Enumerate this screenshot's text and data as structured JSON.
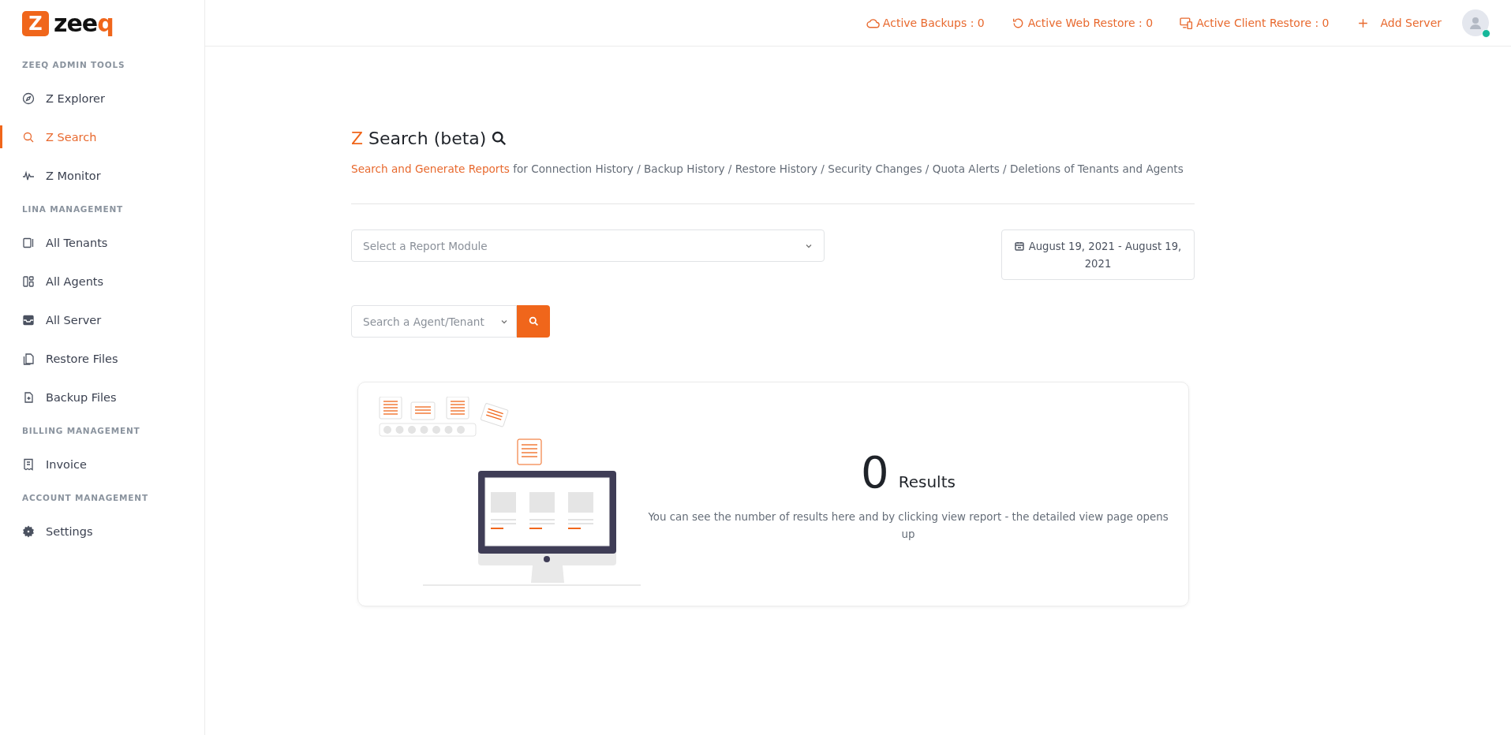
{
  "brand": {
    "mark": "Z",
    "name": "zee",
    "name_accent": "q"
  },
  "sidebar": {
    "sections": [
      {
        "title": "ZEEQ ADMIN TOOLS",
        "items": [
          {
            "label": "Z Explorer",
            "selected": false
          },
          {
            "label": "Z Search",
            "selected": true
          },
          {
            "label": "Z Monitor",
            "selected": false
          }
        ]
      },
      {
        "title": "LINA MANAGEMENT",
        "items": [
          {
            "label": "All Tenants",
            "selected": false
          },
          {
            "label": "All Agents",
            "selected": false
          },
          {
            "label": "All Server",
            "selected": false
          },
          {
            "label": "Restore Files",
            "selected": false
          },
          {
            "label": "Backup Files",
            "selected": false
          }
        ]
      },
      {
        "title": "BILLING MANAGEMENT",
        "items": [
          {
            "label": "Invoice",
            "selected": false
          }
        ]
      },
      {
        "title": "ACCOUNT MANAGEMENT",
        "items": [
          {
            "label": "Settings",
            "selected": false
          }
        ]
      }
    ]
  },
  "topbar": {
    "items": [
      {
        "label": "Active Backups : 0"
      },
      {
        "label": "Active Web Restore : 0"
      },
      {
        "label": "Active Client Restore : 0"
      },
      {
        "label": "Add Server"
      }
    ],
    "user": {
      "online": true
    }
  },
  "page": {
    "title_accent": "Z",
    "title": "Search (beta)",
    "subtitle_link": "Search and Generate Reports",
    "subtitle": "for Connection History / Backup History / Restore History / Security Changes / Quota Alerts / Deletions of Tenants and Agents"
  },
  "report_module": {
    "placeholder": "Select a Report Module"
  },
  "date_range": {
    "value": "August 19, 2021 - August 19, 2021"
  },
  "agent_search": {
    "placeholder": "Search a Agent/Tenant"
  },
  "results": {
    "count": "0",
    "label": "Results",
    "description": "You can see the number of results here and by clicking view report - the detailed view page opens up"
  }
}
